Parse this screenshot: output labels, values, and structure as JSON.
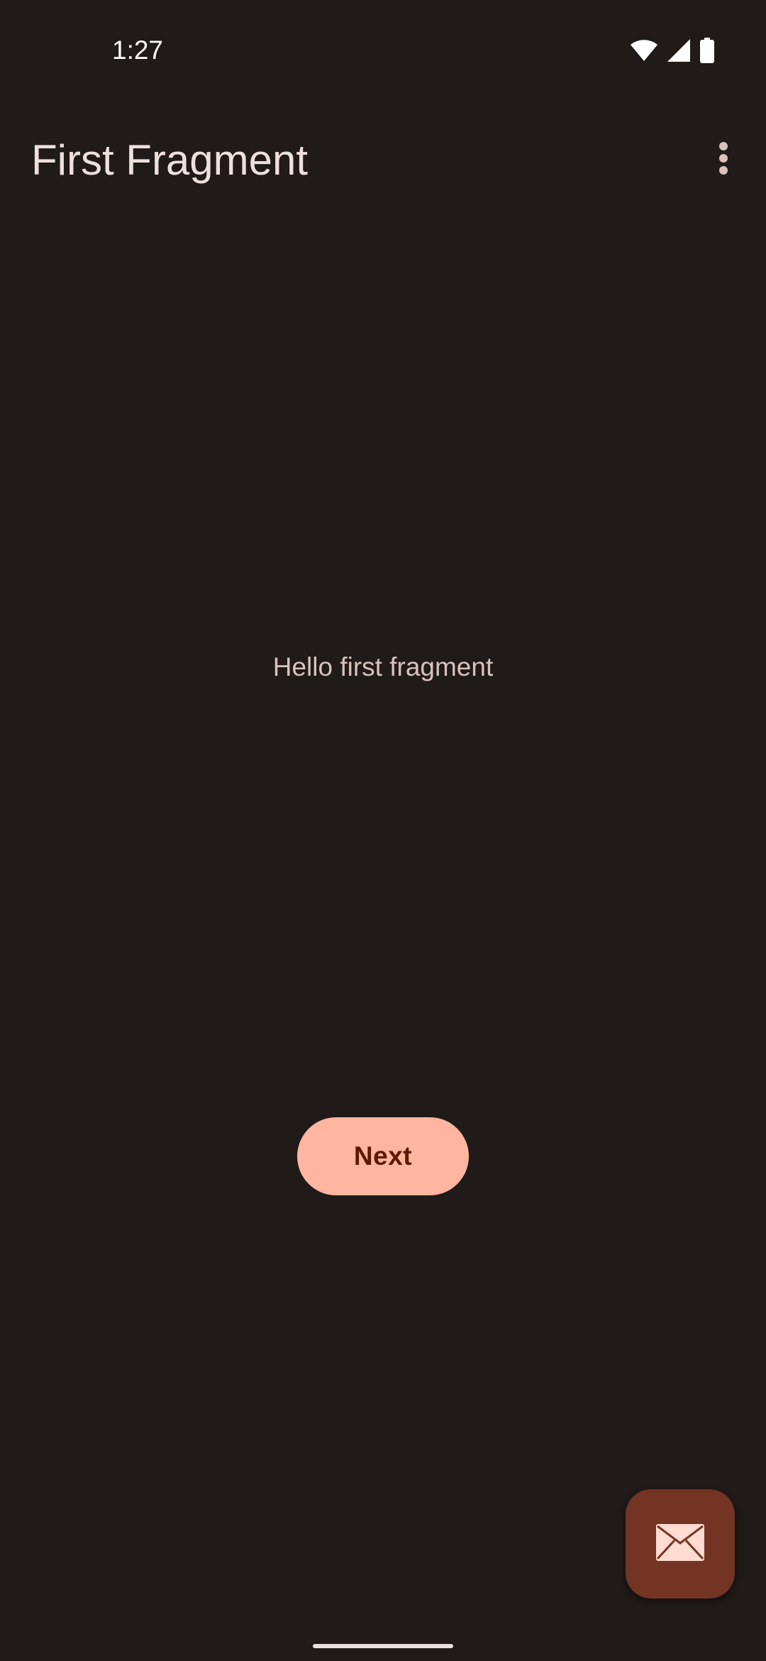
{
  "status_bar": {
    "time": "1:27",
    "icons": [
      "wifi-icon",
      "cell-signal-icon",
      "battery-icon"
    ]
  },
  "app_bar": {
    "title": "First Fragment",
    "overflow_icon": "more-vert-icon"
  },
  "content": {
    "message": "Hello first fragment",
    "next_label": "Next"
  },
  "fab": {
    "icon": "email-icon"
  },
  "colors": {
    "background": "#201a19",
    "primary_container_button": "#ffb59f",
    "on_button": "#5d1900",
    "fab": "#733424",
    "on_surface": "#ede0dd"
  }
}
